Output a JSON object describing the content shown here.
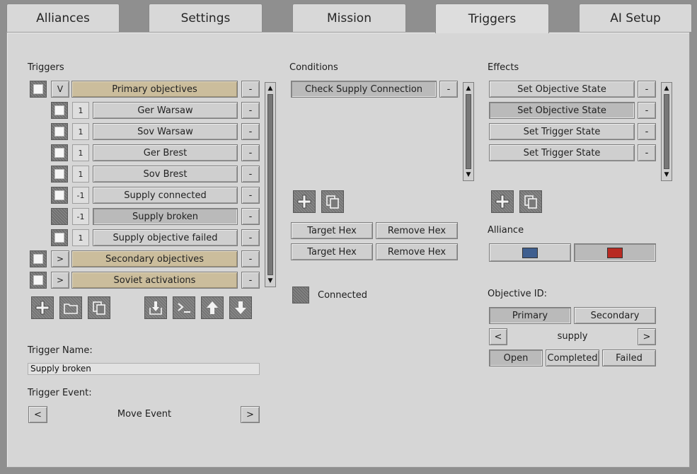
{
  "tabs": [
    "Alliances",
    "Settings",
    "Mission",
    "Triggers",
    "AI Setup"
  ],
  "triggers": {
    "heading": "Triggers",
    "rows": [
      {
        "check": true,
        "level": 0,
        "toggle": "V",
        "label": "Primary objectives",
        "tan": true,
        "dark": false
      },
      {
        "check": true,
        "level": 1,
        "count": "1",
        "label": "Ger Warsaw",
        "tan": false,
        "dark": false
      },
      {
        "check": true,
        "level": 1,
        "count": "1",
        "label": "Sov Warsaw",
        "tan": false,
        "dark": false
      },
      {
        "check": true,
        "level": 1,
        "count": "1",
        "label": "Ger Brest",
        "tan": false,
        "dark": false
      },
      {
        "check": true,
        "level": 1,
        "count": "1",
        "label": "Sov Brest",
        "tan": false,
        "dark": false
      },
      {
        "check": true,
        "level": 1,
        "count": "-1",
        "label": "Supply connected",
        "tan": false,
        "dark": false
      },
      {
        "check": false,
        "level": 1,
        "count": "-1",
        "label": "Supply broken",
        "tan": false,
        "dark": true
      },
      {
        "check": true,
        "level": 1,
        "count": "1",
        "label": "Supply objective failed",
        "tan": false,
        "dark": false
      },
      {
        "check": true,
        "level": 0,
        "toggle": ">",
        "label": "Secondary objectives",
        "tan": true,
        "dark": false
      },
      {
        "check": true,
        "level": 0,
        "toggle": ">",
        "label": "Soviet activations",
        "tan": true,
        "dark": false
      }
    ],
    "minus": "-",
    "name_label": "Trigger Name:",
    "name_value": "Supply broken",
    "event_label": "Trigger Event:",
    "event_value": "Move Event",
    "prev": "<",
    "next": ">"
  },
  "conditions": {
    "heading": "Conditions",
    "items": [
      "Check Supply Connection"
    ],
    "target_hex": "Target Hex",
    "remove_hex": "Remove Hex",
    "connected_label": "Connected"
  },
  "effects": {
    "heading": "Effects",
    "items": [
      "Set Objective State",
      "Set Objective State",
      "Set Trigger State",
      "Set Trigger State"
    ],
    "alliance_label": "Alliance",
    "alliance_colors": [
      "#3f5f8f",
      "#b82a22"
    ],
    "objective_label": "Objective ID:",
    "primary": "Primary",
    "secondary": "Secondary",
    "objective_value": "supply",
    "open": "Open",
    "completed": "Completed",
    "failed": "Failed"
  }
}
